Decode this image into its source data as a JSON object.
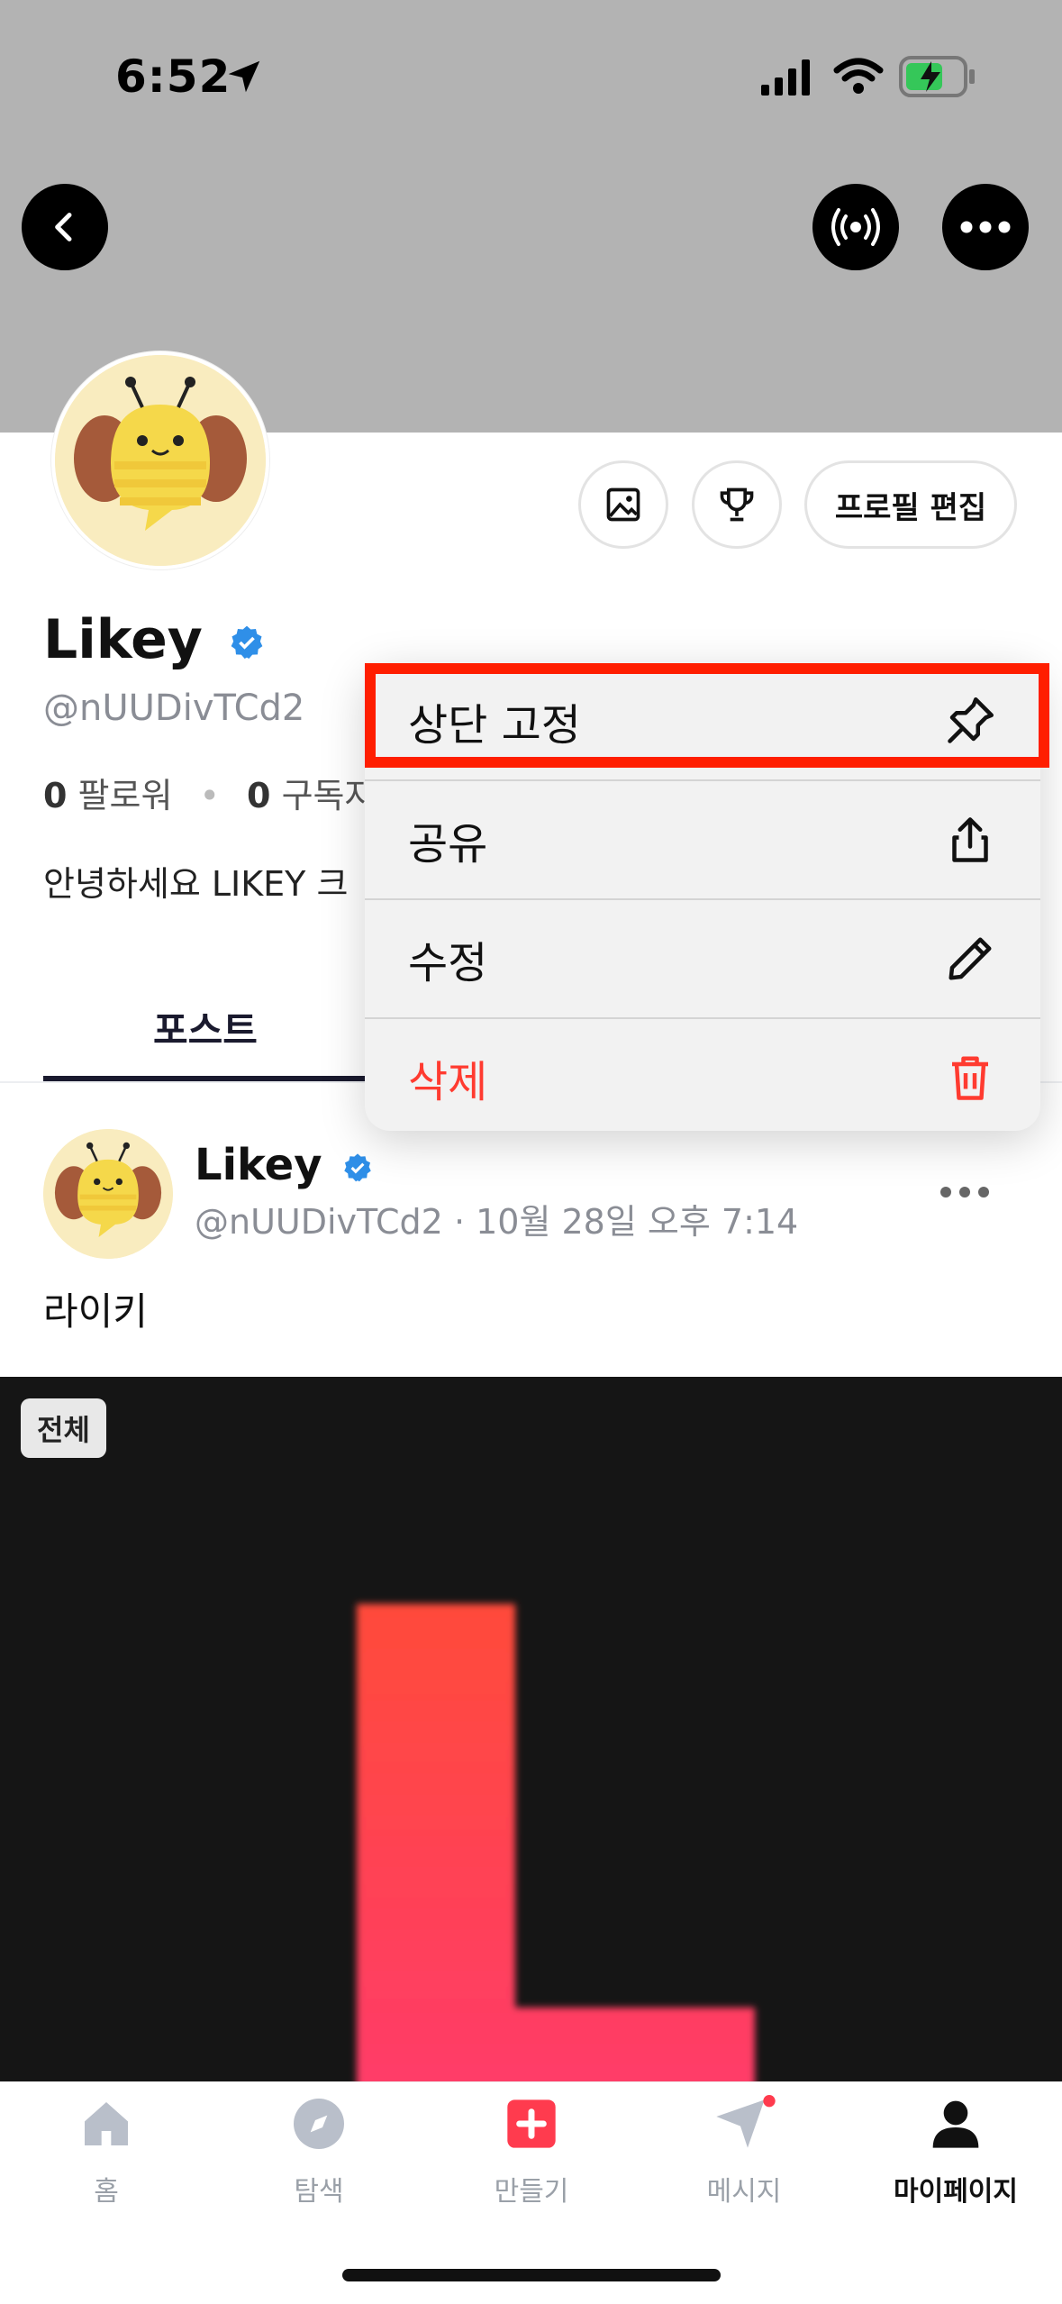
{
  "status_bar": {
    "time": "6:52"
  },
  "profile": {
    "name": "Likey",
    "handle": "@nUUDivTCd2",
    "followers_count": "0",
    "followers_label": "팔로워",
    "subscribers_count": "0",
    "subscribers_label": "구독자",
    "bio": "안녕하세요 LIKEY 크",
    "edit_profile_label": "프로필 편집"
  },
  "tabs": [
    {
      "label": "포스트"
    }
  ],
  "post": {
    "author": "Likey",
    "handle": "@nUUDivTCd2",
    "timestamp": "10월 28일 오후 7:14",
    "text": "라이키",
    "media_badge": "전체"
  },
  "context_menu": {
    "items": [
      {
        "label": "상단 고정",
        "icon": "pin-icon"
      },
      {
        "label": "공유",
        "icon": "share-icon"
      },
      {
        "label": "수정",
        "icon": "pencil-icon"
      },
      {
        "label": "삭제",
        "icon": "trash-icon",
        "color": "#ff3b30"
      }
    ]
  },
  "bottom_nav": {
    "items": [
      {
        "label": "홈",
        "icon": "home-icon"
      },
      {
        "label": "탐색",
        "icon": "compass-icon"
      },
      {
        "label": "만들기",
        "icon": "plus-icon"
      },
      {
        "label": "메시지",
        "icon": "send-icon"
      },
      {
        "label": "마이페이지",
        "icon": "user-icon",
        "active": true
      }
    ]
  },
  "colors": {
    "accent": "#ff3b4e",
    "verified": "#2f8fe8",
    "danger": "#ff3b30",
    "highlight": "#ff1e00"
  }
}
